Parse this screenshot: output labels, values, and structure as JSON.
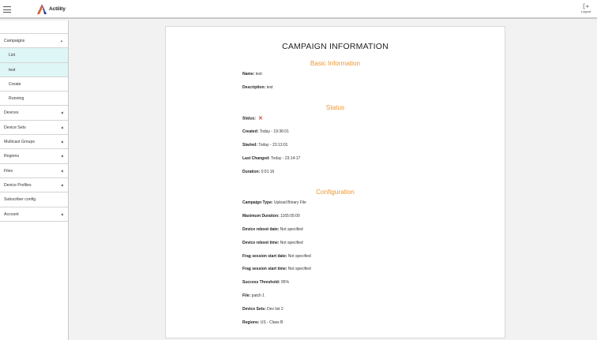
{
  "header": {
    "brand": "Actility",
    "logout_label": "Logout"
  },
  "sidebar": {
    "items": [
      {
        "label": "Campaigns",
        "caret": "▲"
      },
      {
        "label": "List"
      },
      {
        "label": "test"
      },
      {
        "label": "Create"
      },
      {
        "label": "Running"
      },
      {
        "label": "Devices",
        "caret": "◀"
      },
      {
        "label": "Device Sets",
        "caret": "◀"
      },
      {
        "label": "Multicast Groups",
        "caret": "◀"
      },
      {
        "label": "Regions",
        "caret": "◀"
      },
      {
        "label": "Files",
        "caret": "◀"
      },
      {
        "label": "Device Profiles",
        "caret": "◀"
      },
      {
        "label": "Subscriber config"
      },
      {
        "label": "Account",
        "caret": "◀"
      }
    ]
  },
  "main": {
    "title": "CAMPAIGN INFORMATION",
    "basic": {
      "heading": "Basic Information",
      "name_label": "Name:",
      "name_value": "test",
      "description_label": "Description:",
      "description_value": "test"
    },
    "status": {
      "heading": "Status",
      "status_label": "Status:",
      "status_icon": "✕",
      "created_label": "Created:",
      "created_value": "Today - 19:36:01",
      "started_label": "Started:",
      "started_value": "Today - 23:13:01",
      "changed_label": "Last Changed:",
      "changed_value": "Today - 23:14:17",
      "duration_label": "Duration:",
      "duration_value": "0:01:16"
    },
    "config": {
      "heading": "Configuration",
      "type_label": "Campaign Type:",
      "type_value": "Upload Binary File",
      "maxdur_label": "Maximum Duration:",
      "maxdur_value": "1165:05:00",
      "rebootdate_label": "Device reboot date:",
      "rebootdate_value": "Not specified",
      "reboottime_label": "Device reboot time:",
      "reboottime_value": "Not specified",
      "fragdate_label": "Frag session start date:",
      "fragdate_value": "Not specified",
      "fragtime_label": "Frag session start time:",
      "fragtime_value": "Not specified",
      "threshold_label": "Success Threshold:",
      "threshold_value": "95%",
      "file_label": "File:",
      "file_value": "patch 1",
      "sets_label": "Device Sets:",
      "sets_value": "Dev list 2",
      "regions_label": "Regions:",
      "regions_value": "US - Class B"
    }
  }
}
